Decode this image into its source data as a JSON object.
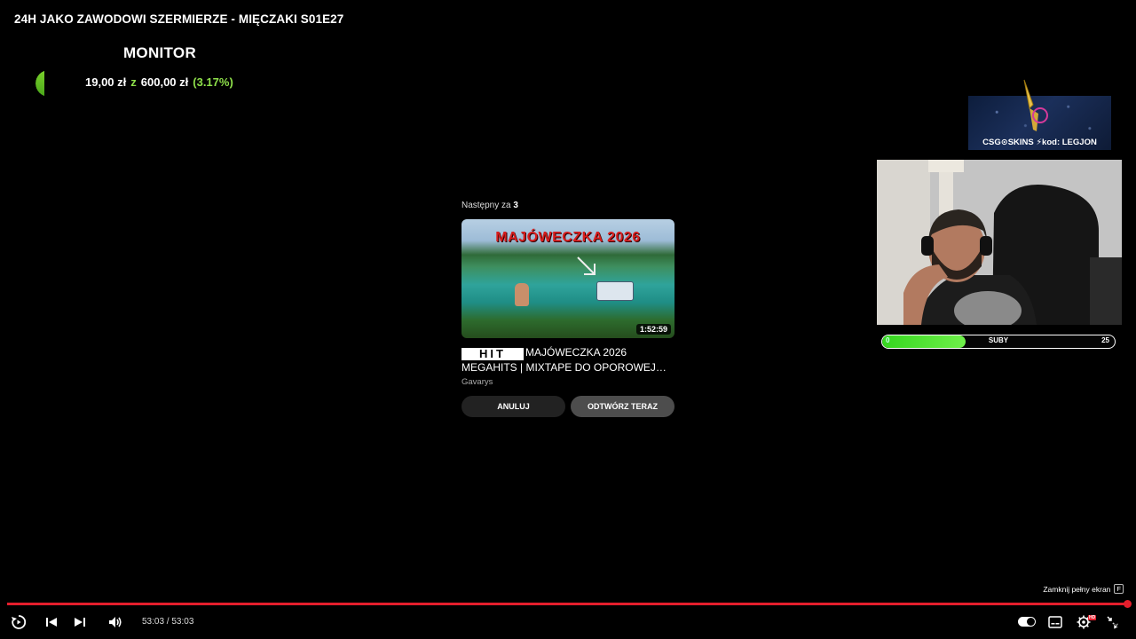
{
  "video": {
    "title": "24H JAKO ZAWODOWI SZERMIERZE - MIĘCZAKI S01E27"
  },
  "donation_goal": {
    "title": "MONITOR",
    "current": "19,00 zł",
    "separator": "z",
    "target": "600,00 zł",
    "percent_label": "(3.17%)",
    "progress_fraction": 0.0317,
    "color": "#7ad12b"
  },
  "ad_banner": {
    "text": "CSG⊙SKINS ⚡kod: LEGJON"
  },
  "subs_bar": {
    "min": "0",
    "label": "SUBY",
    "max": "25",
    "progress_fraction": 0.36,
    "color": "#35d61f"
  },
  "up_next": {
    "label_prefix": "Następny za",
    "countdown": "3",
    "thumbnail_text": "MAJÓWECZKA 2026",
    "duration": "1:52:59",
    "logo_text": "HIT",
    "title": "MAJÓWECZKA 2026 MEGAHITS | MIXTAPE DO OPOROWEJ…",
    "channel": "Gavarys",
    "cancel_label": "ANULUJ",
    "play_now_label": "ODTWÓRZ TERAZ"
  },
  "player": {
    "time_display": "53:03 / 53:03",
    "progress_fraction": 1.0,
    "exit_fullscreen_tooltip": "Zamknij pełny ekran",
    "exit_fullscreen_key": "F",
    "accent_color": "#e41e2c",
    "quality_badge": "HD",
    "icons": [
      "replay-icon",
      "previous-icon",
      "next-icon",
      "volume-icon",
      "autoplay-toggle",
      "subtitles-icon",
      "settings-icon",
      "exit-fullscreen-icon"
    ]
  }
}
